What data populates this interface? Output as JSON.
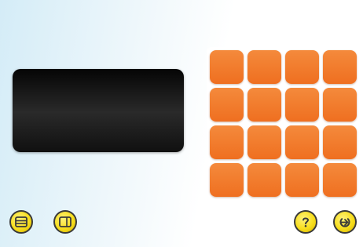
{
  "header": {
    "title_line1": "",
    "title_line2": "",
    "hint_line": ""
  },
  "display": {
    "lines": [
      "",
      "",
      "",
      "",
      ""
    ]
  },
  "keypad": {
    "label": "",
    "keys": [
      [
        "",
        "",
        "",
        ""
      ],
      [
        "",
        "",
        "",
        ""
      ],
      [
        "",
        "",
        "",
        ""
      ],
      [
        "",
        "",
        "",
        ""
      ]
    ]
  },
  "buttons": {
    "menu_icon": "menu-icon",
    "screen_icon": "screen-icon",
    "help_icon": "help-icon",
    "exit_icon": "exit-icon"
  },
  "colors": {
    "key_orange": "#ef6f20",
    "button_yellow": "#f7de1c",
    "display_text_green": "#39d04a",
    "display_background": "#050505"
  }
}
